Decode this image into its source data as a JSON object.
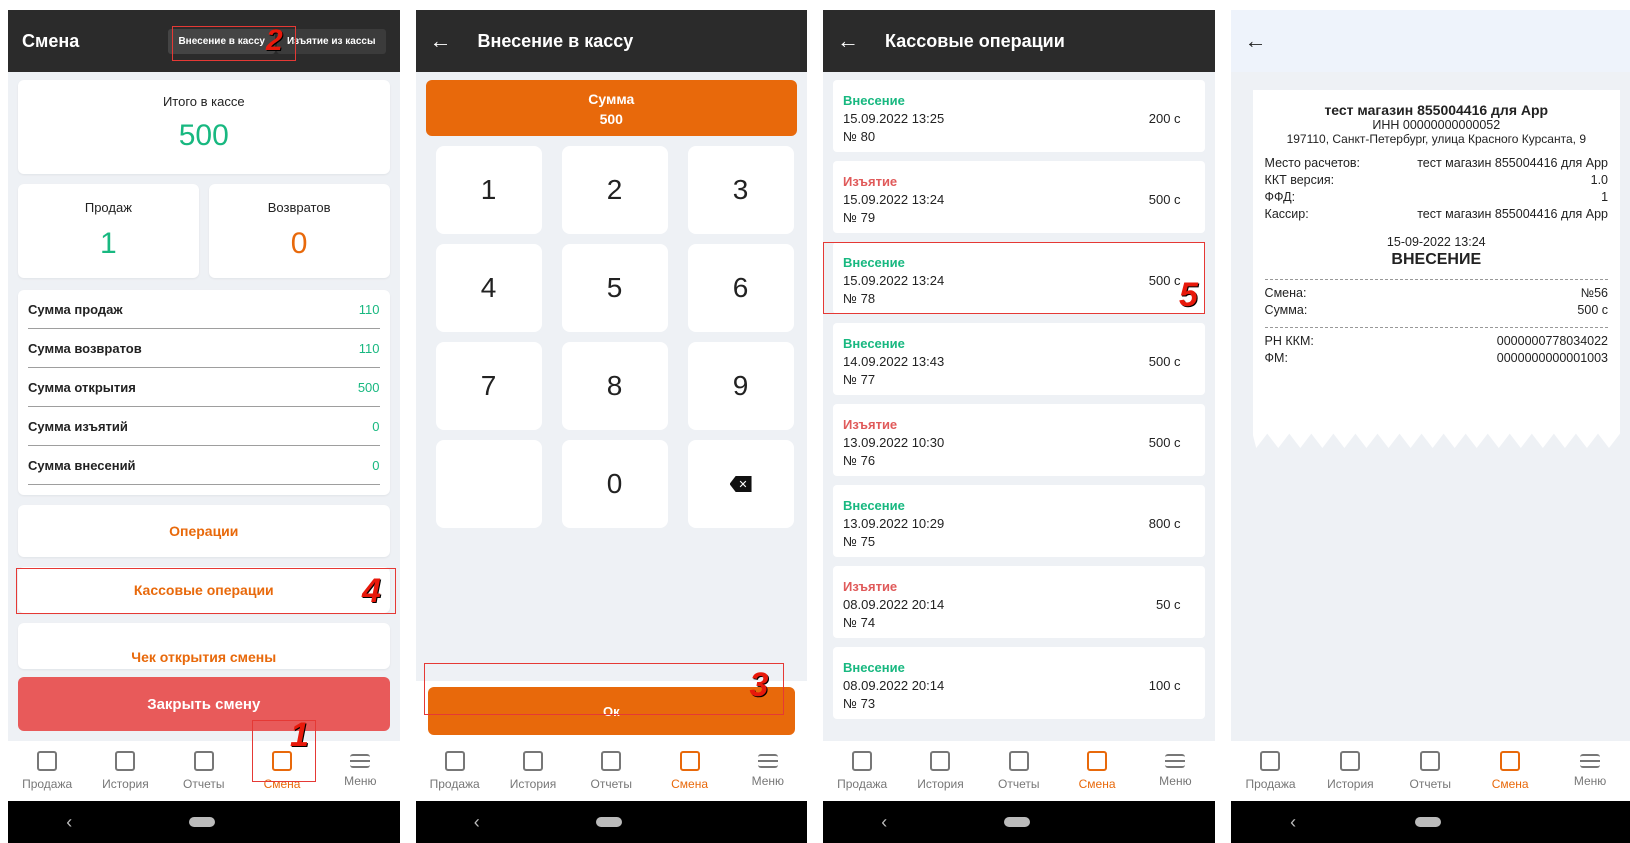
{
  "nav": {
    "items": [
      "Продажа",
      "История",
      "Отчеты",
      "Смена",
      "Меню"
    ],
    "active": "Смена"
  },
  "marks": {
    "m1": "1",
    "m2": "2",
    "m3": "3",
    "m4": "4",
    "m5": "5"
  },
  "colors": {
    "accent": "#e8690b",
    "green": "#18b880",
    "red": "#e05a5a",
    "danger": "#e85a5a",
    "appbar": "#2b2b2b"
  },
  "shift": {
    "title": "Смена",
    "tab_in": "Внесение в кассу",
    "tab_out": "Изъятие из кассы",
    "total_label": "Итого в кассе",
    "total_value": "500",
    "sales_label": "Продаж",
    "sales_value": "1",
    "returns_label": "Возвратов",
    "returns_value": "0",
    "stats": [
      {
        "label": "Сумма продаж",
        "value": "110"
      },
      {
        "label": "Сумма возвратов",
        "value": "110"
      },
      {
        "label": "Сумма открытия",
        "value": "500"
      },
      {
        "label": "Сумма изъятий",
        "value": "0"
      },
      {
        "label": "Сумма внесений",
        "value": "0"
      }
    ],
    "operations": "Операции",
    "cash_operations": "Кассовые операции",
    "open_receipt": "Чек открытия смены",
    "close_shift": "Закрыть смену"
  },
  "deposit": {
    "title": "Внесение в кассу",
    "sum_label": "Сумма",
    "sum_value": "500",
    "keys": [
      "1",
      "2",
      "3",
      "4",
      "5",
      "6",
      "7",
      "8",
      "9",
      "",
      "0"
    ],
    "ok": "Ок"
  },
  "cashops": {
    "title": "Кассовые операции",
    "items": [
      {
        "type": "Внесение",
        "date": "15.09.2022 13:25",
        "num": "№ 80",
        "amount": "200 с"
      },
      {
        "type": "Изъятие",
        "date": "15.09.2022 13:24",
        "num": "№ 79",
        "amount": "500 с"
      },
      {
        "type": "Внесение",
        "date": "15.09.2022 13:24",
        "num": "№ 78",
        "amount": "500 с"
      },
      {
        "type": "Внесение",
        "date": "14.09.2022 13:43",
        "num": "№ 77",
        "amount": "500 с"
      },
      {
        "type": "Изъятие",
        "date": "13.09.2022 10:30",
        "num": "№ 76",
        "amount": "500 с"
      },
      {
        "type": "Внесение",
        "date": "13.09.2022 10:29",
        "num": "№ 75",
        "amount": "800 с"
      },
      {
        "type": "Изъятие",
        "date": "08.09.2022 20:14",
        "num": "№ 74",
        "amount": "50 с"
      },
      {
        "type": "Внесение",
        "date": "08.09.2022 20:14",
        "num": "№ 73",
        "amount": "100 с"
      }
    ]
  },
  "receipt": {
    "shop": "тест магазин 855004416 для App",
    "inn": "ИНН 00000000000052",
    "address": "197110, Санкт-Петербург, улица Красного Курсанта, 9",
    "place_label": "Место расчетов:",
    "place_value": "тест магазин 855004416 для App",
    "kkt_label": "ККТ версия:",
    "kkt_value": "1.0",
    "ffd_label": "ФФД:",
    "ffd_value": "1",
    "cashier_label": "Кассир:",
    "cashier_value": "тест магазин 855004416 для App",
    "datetime": "15-09-2022 13:24",
    "doc_type": "ВНЕСЕНИЕ",
    "shift_label": "Смена:",
    "shift_value": "№56",
    "sum_label": "Сумма:",
    "sum_value": "500 с",
    "rn_label": "РН ККМ:",
    "rn_value": "0000000778034022",
    "fm_label": "ФМ:",
    "fm_value": "0000000000001003"
  }
}
